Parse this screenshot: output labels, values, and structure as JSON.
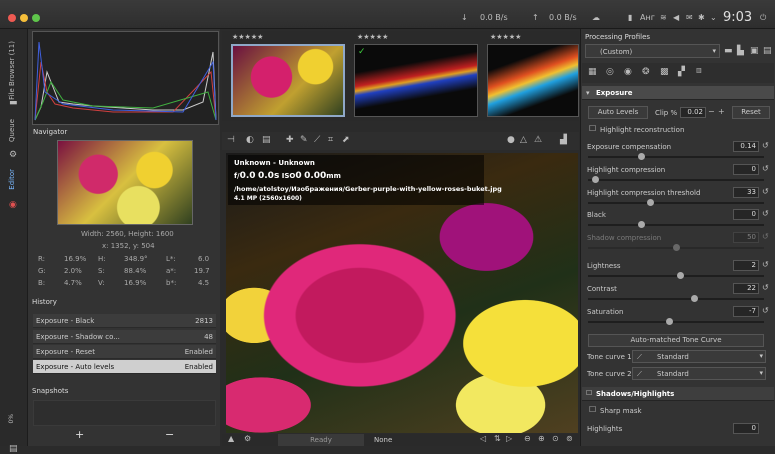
{
  "titlebar": {
    "net_down": "0.0 B/s",
    "net_up": "0.0 B/s",
    "lang": "Анг",
    "clock": "9:03"
  },
  "vertical_tabs": {
    "file_browser": "File Browser (11)",
    "queue": "Queue",
    "editor": "Editor"
  },
  "navigator": {
    "title": "Navigator",
    "size": "Width: 2560, Height: 1600",
    "coords": "x: 1352, y: 504",
    "rows": [
      [
        "R:",
        "16.9%",
        "H:",
        "348.9°",
        "L*:",
        "6.0"
      ],
      [
        "G:",
        "2.0%",
        "S:",
        "88.4%",
        "a*:",
        "19.7"
      ],
      [
        "B:",
        "4.7%",
        "V:",
        "16.9%",
        "b*:",
        "4.5"
      ]
    ]
  },
  "history": {
    "title": "History",
    "rows": [
      {
        "name": "Exposure - Black",
        "value": "2813"
      },
      {
        "name": "Exposure - Shadow co...",
        "value": "48"
      },
      {
        "name": "Exposure - Reset",
        "value": "Enabled"
      },
      {
        "name": "Exposure - Auto levels",
        "value": "Enabled"
      }
    ]
  },
  "snapshots": {
    "title": "Snapshots",
    "add": "+",
    "remove": "−"
  },
  "left_progress": "0%",
  "image_info": {
    "line1": "Unknown - Unknown",
    "f": "f/",
    "f_val": "0.0",
    "shutter": "0.0s",
    "iso": "ISO",
    "iso_val": "0",
    "focal": "0.00",
    "focal_unit": "mm",
    "path": "/home/atolstoy/Изображения/Gerber-purple-with-yellow-roses-buket.jpg",
    "mp": "4.1 MP (2560x1600)"
  },
  "status": {
    "ready": "Ready",
    "none": "None"
  },
  "right": {
    "profiles_title": "Processing Profiles",
    "profile": "(Custom)",
    "exposure_title": "Exposure",
    "auto_levels": "Auto Levels",
    "clip_label": "Clip %",
    "clip_val": "0.02",
    "reset": "Reset",
    "highlight_recon": "Highlight reconstruction",
    "sliders": [
      {
        "label": "Exposure compensation",
        "value": "0.14",
        "pos": 0.3
      },
      {
        "label": "Highlight compression",
        "value": "0",
        "pos": 0.04
      },
      {
        "label": "Highlight compression threshold",
        "value": "33",
        "pos": 0.35
      },
      {
        "label": "Black",
        "value": "0",
        "pos": 0.3
      },
      {
        "label": "Shadow compression",
        "value": "50",
        "pos": 0.5
      },
      {
        "label": "Lightness",
        "value": "2",
        "pos": 0.52
      },
      {
        "label": "Contrast",
        "value": "22",
        "pos": 0.6
      },
      {
        "label": "Saturation",
        "value": "-7",
        "pos": 0.46
      }
    ],
    "amtc": "Auto-matched Tone Curve",
    "tone1": "Tone curve 1",
    "tone2": "Tone curve 2",
    "standard": "Standard",
    "shadows_title": "Shadows/Highlights",
    "sharp_mask": "Sharp mask",
    "highlights": "Highlights",
    "highlights_val": "0"
  }
}
